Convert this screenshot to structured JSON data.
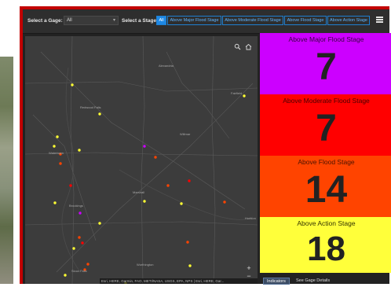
{
  "header": {
    "gage_label": "Select a Gage:",
    "gage_value": "All",
    "stage_label": "Select a Stage:",
    "stage_buttons": [
      "All",
      "Above Major Flood Stage",
      "Above Moderate Flood Stage",
      "Above Flood Stage",
      "Above Action Stage"
    ],
    "menu_icon": "hamburger-menu-icon"
  },
  "map": {
    "places": [
      "Alexandria",
      "Fairfield",
      "Willmar",
      "Marshall",
      "Brookings",
      "Watertown",
      "Worthington",
      "Sioux Falls",
      "Hudson",
      "Redwood Falls"
    ],
    "attribution": "Esri, HERE, Garmin, FAO, METI/NASA, USGS, EPA, NPS | Esri, HERE, Gar...",
    "zoom_in": "+",
    "zoom_out": "−",
    "search_icon": "search-icon",
    "home_icon": "home-icon"
  },
  "indicators": [
    {
      "title": "Above Major Flood Stage",
      "value": "7",
      "bg": "#cc00ff",
      "text": "#222222"
    },
    {
      "title": "Above Moderate Flood Stage",
      "value": "7",
      "bg": "#ff0000",
      "text": "#222222"
    },
    {
      "title": "Above Flood Stage",
      "value": "14",
      "bg": "#ff4400",
      "text": "#222222"
    },
    {
      "title": "Above Action Stage",
      "value": "18",
      "bg": "#ffff3a",
      "text": "#222222"
    }
  ],
  "tabs": {
    "indicators": "Indicators",
    "gage_details": "See Gage Details"
  }
}
